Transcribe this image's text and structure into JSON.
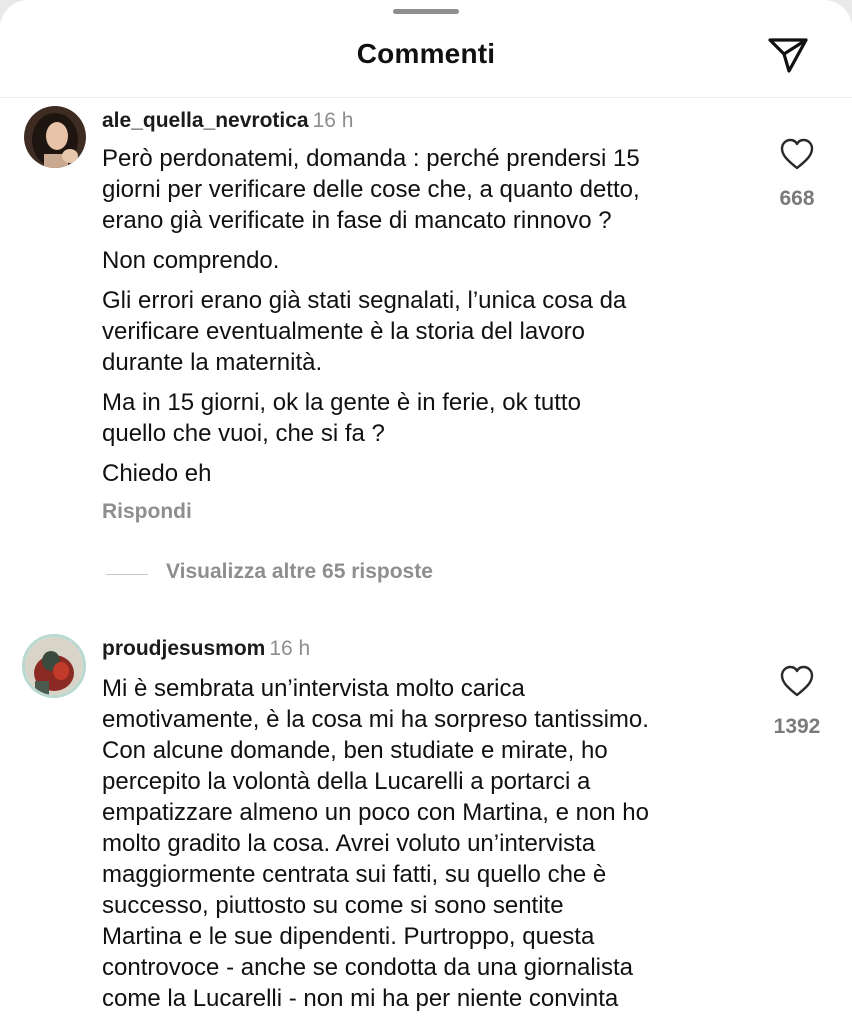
{
  "header": {
    "title": "Commenti"
  },
  "comments": [
    {
      "username": "ale_quella_nevrotica",
      "time": "16 h",
      "paragraphs": [
        "Però perdonatemi, domanda : perché prendersi 15\ngiorni per verificare delle cose che, a quanto detto,\nerano già verificate in fase di mancato rinnovo ?",
        "Non comprendo.",
        "Gli errori erano già stati segnalati, l’unica cosa da\nverificare eventualmente è la storia del lavoro\ndurante la maternità.",
        "Ma in 15 giorni, ok la gente è in ferie, ok tutto\nquello che vuoi, che si fa ?",
        "Chiedo eh"
      ],
      "likes": "668",
      "reply_label": "Rispondi",
      "more_replies_label": "Visualizza altre 65 risposte"
    },
    {
      "username": "proudjesusmom",
      "time": "16 h",
      "paragraphs": [
        "Mi è sembrata un’intervista molto carica\nemotivamente, è la cosa mi ha sorpreso tantissimo.\nCon alcune domande, ben studiate e mirate, ho\npercepito la volontà della Lucarelli a portarci a\nempatizzare almeno un poco con Martina, e non ho\nmolto gradito la cosa. Avrei voluto un’intervista\nmaggiormente centrata sui fatti, su quello che è\nsuccesso, piuttosto su come si sono sentite\nMartina e le sue dipendenti. Purtroppo, questa\ncontrovoce - anche se condotta da una giornalista\ncome la Lucarelli - non mi ha per niente convinta"
      ],
      "likes": "1392"
    }
  ],
  "icons": {
    "send": "paper-plane-icon",
    "like": "heart-outline-icon"
  },
  "colors": {
    "text": "#111111",
    "secondary_text": "#8e8e8e",
    "background": "#ffffff"
  }
}
